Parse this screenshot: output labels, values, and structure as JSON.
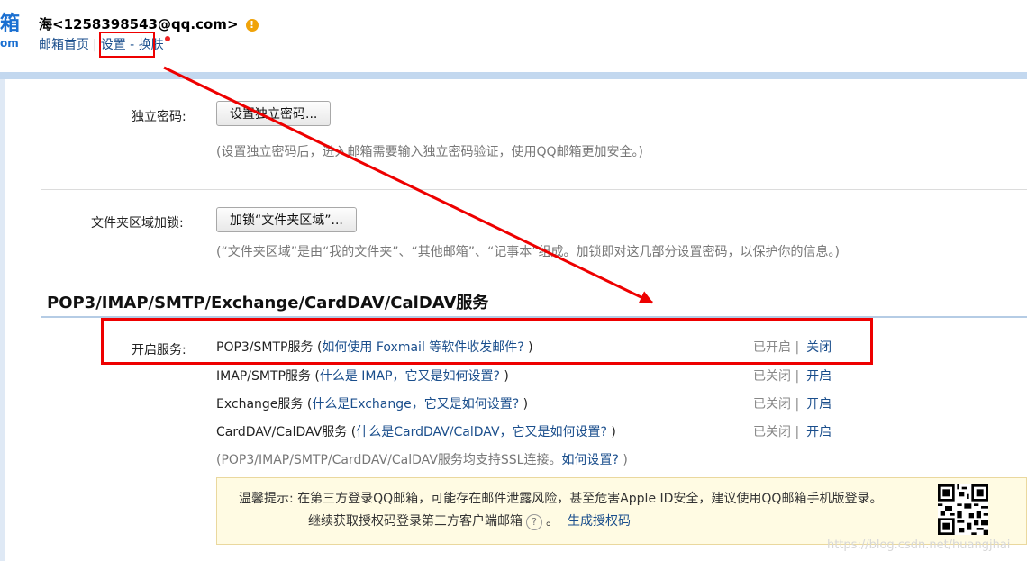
{
  "header": {
    "logo_fragment": "箱",
    "logo_fragment_small": "om",
    "user_email": "海<1258398543@qq.com>",
    "warn_glyph": "!",
    "nav": {
      "home": "邮箱首页",
      "settings": "设置",
      "dash": "-",
      "skin": "换肤"
    }
  },
  "settings": {
    "independent_password": {
      "label": "独立密码:",
      "button": "设置独立密码...",
      "note": "(设置独立密码后，进入邮箱需要输入独立密码验证，使用QQ邮箱更加安全。)"
    },
    "folder_lock": {
      "label": "文件夹区域加锁:",
      "button": "加锁“文件夹区域”...",
      "note": "(“文件夹区域”是由“我的文件夹”、“其他邮箱”、“记事本”组成。加锁即对这几部分设置密码，以保护你的信息。)"
    }
  },
  "section": {
    "title": "POP3/IMAP/SMTP/Exchange/CardDAV/CalDAV服务",
    "enable_label": "开启服务:",
    "services": [
      {
        "name": "POP3/SMTP服务",
        "open": " (",
        "link": "如何使用 Foxmail 等软件收发邮件?",
        "close": " )",
        "status": "已开启",
        "sep": "|",
        "action": "关闭"
      },
      {
        "name": "IMAP/SMTP服务",
        "open": " (",
        "link": "什么是 IMAP，它又是如何设置?",
        "close": " )",
        "status": "已关闭",
        "sep": "|",
        "action": "开启"
      },
      {
        "name": "Exchange服务",
        "open": " (",
        "link": "什么是Exchange，它又是如何设置?",
        "close": " )",
        "status": "已关闭",
        "sep": "|",
        "action": "开启"
      },
      {
        "name": "CardDAV/CalDAV服务",
        "open": " (",
        "link": "什么是CardDAV/CalDAV，它又是如何设置?",
        "close": " )",
        "status": "已关闭",
        "sep": "|",
        "action": "开启"
      }
    ],
    "ssl_note": "(POP3/IMAP/SMTP/CardDAV/CalDAV服务均支持SSL连接。",
    "ssl_link": "如何设置?",
    "ssl_close": " )"
  },
  "tip": {
    "line1": "温馨提示: 在第三方登录QQ邮箱，可能存在邮件泄露风险，甚至危害Apple ID安全，建议使用QQ邮箱手机版登录。",
    "line2": "继续获取授权码登录第三方客户端邮箱",
    "help_glyph": "?",
    "line2_end": "。",
    "generate_link": "生成授权码"
  },
  "watermark": "https://blog.csdn.net/huangjhai",
  "colors": {
    "link": "#1a4e8c",
    "highlight": "#e00000",
    "tip_bg": "#fffbe3"
  }
}
